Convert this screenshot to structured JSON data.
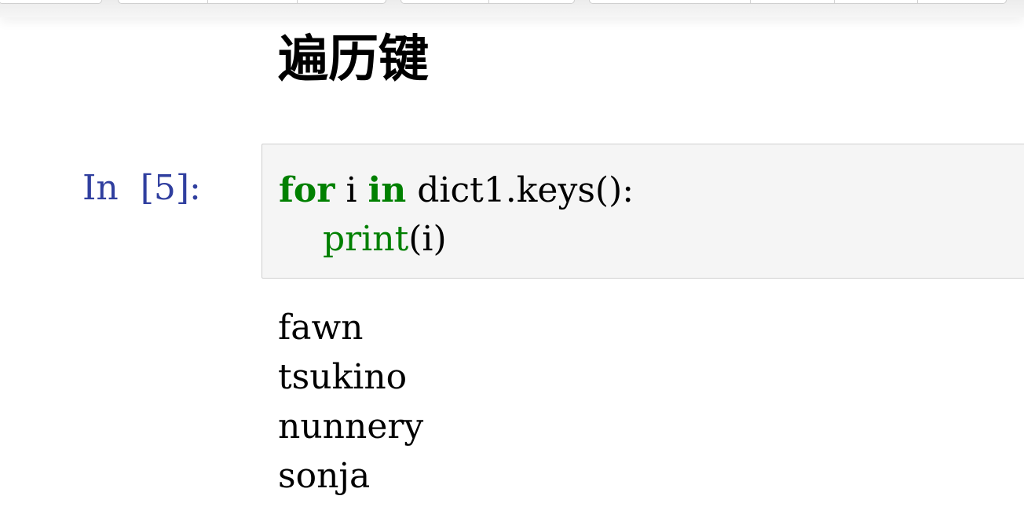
{
  "heading": "遍历键",
  "cell": {
    "prompt": "In  [5]:",
    "code": {
      "line1": {
        "for": "for",
        "var": " i ",
        "in": "in",
        "rest": " dict1.keys():"
      },
      "line2": {
        "indent": "    ",
        "func": "print",
        "args": "(i)"
      }
    },
    "output": [
      "fawn",
      "tsukino",
      "nunnery",
      "sonja"
    ]
  },
  "colors": {
    "prompt": "#303F9F",
    "keyword": "#008000",
    "cell_background": "#f5f5f5",
    "cell_border": "#cfcfcf"
  }
}
